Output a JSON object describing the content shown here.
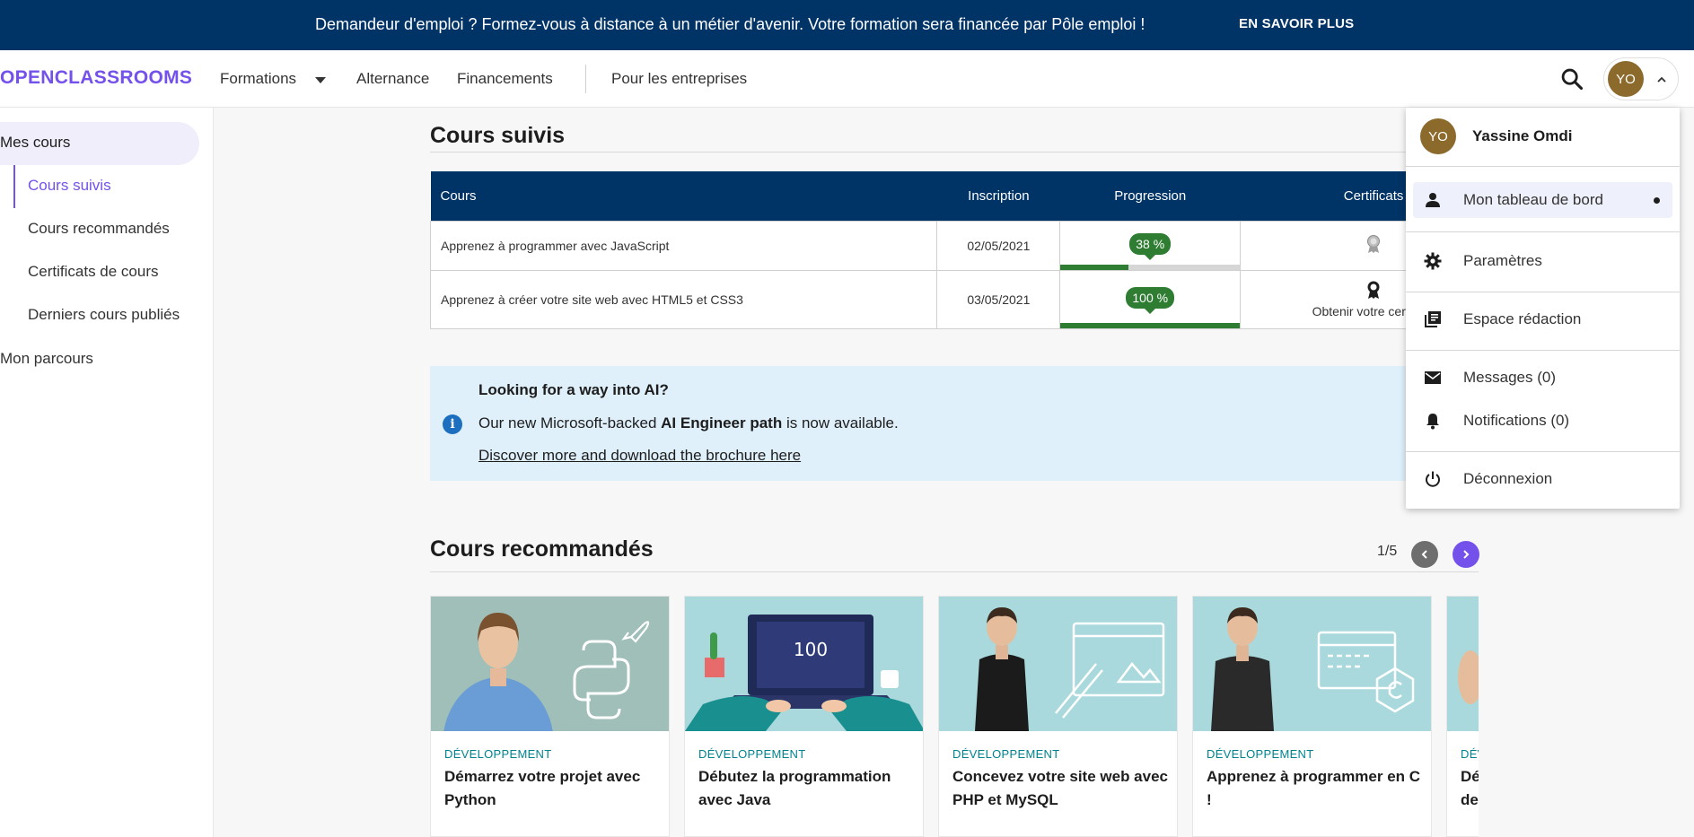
{
  "banner": {
    "text": "Demandeur d'emploi ? Formez-vous à distance à un métier d'avenir. Votre formation sera financée par Pôle emploi !",
    "link": "EN SAVOIR PLUS"
  },
  "header": {
    "logo": "OPENCLASSROOMS",
    "nav": {
      "formations": "Formations",
      "alternance": "Alternance",
      "financements": "Financements",
      "entreprises": "Pour les entreprises"
    },
    "avatar_initials": "YO"
  },
  "sidebar": {
    "mes_cours": "Mes cours",
    "items": [
      "Cours suivis",
      "Cours recommandés",
      "Certificats de cours",
      "Derniers cours publiés"
    ],
    "mon_parcours": "Mon parcours"
  },
  "cours_suivis": {
    "title": "Cours suivis",
    "columns": [
      "Cours",
      "Inscription",
      "Progression",
      "Certificats"
    ],
    "rows": [
      {
        "cours": "Apprenez à programmer avec JavaScript",
        "inscription": "02/05/2021",
        "progression": "38 %",
        "progress_fraction": 0.38,
        "certificat": ""
      },
      {
        "cours": "Apprenez à créer votre site web avec HTML5 et CSS3",
        "inscription": "03/05/2021",
        "progression": "100 %",
        "progress_fraction": 1.0,
        "certificat": "Obtenir votre certificat"
      }
    ]
  },
  "info": {
    "title": "Looking for a way into AI?",
    "line_pre": "Our new Microsoft-backed ",
    "line_bold": "AI Engineer path",
    "line_post": " is now available.",
    "link": "Discover more and download the brochure here"
  },
  "recommandes": {
    "title": "Cours recommandés",
    "pager": "1/5",
    "cards": [
      {
        "category": "DÉVELOPPEMENT",
        "title": "Démarrez votre projet avec Python"
      },
      {
        "category": "DÉVELOPPEMENT",
        "title": "Débutez la programmation avec Java",
        "image_text": "100"
      },
      {
        "category": "DÉVELOPPEMENT",
        "title": "Concevez votre site web avec PHP et MySQL"
      },
      {
        "category": "DÉVELOPPEMENT",
        "title": "Apprenez à programmer en C !"
      },
      {
        "category": "DÉVELOPPEMENT",
        "title": "Découvrez le fonctionnement des algorithmes"
      }
    ]
  },
  "dropdown": {
    "initials": "YO",
    "name": "Yassine Omdi",
    "items": {
      "dashboard": "Mon tableau de bord",
      "parametres": "Paramètres",
      "redaction": "Espace rédaction",
      "messages": "Messages (0)",
      "notifications": "Notifications (0)",
      "deconnexion": "Déconnexion"
    }
  },
  "colors": {
    "brand_purple": "#7451eb",
    "navy": "#003366",
    "progress_green": "#2e7d32",
    "avatar_brown": "#8c6a2c"
  }
}
